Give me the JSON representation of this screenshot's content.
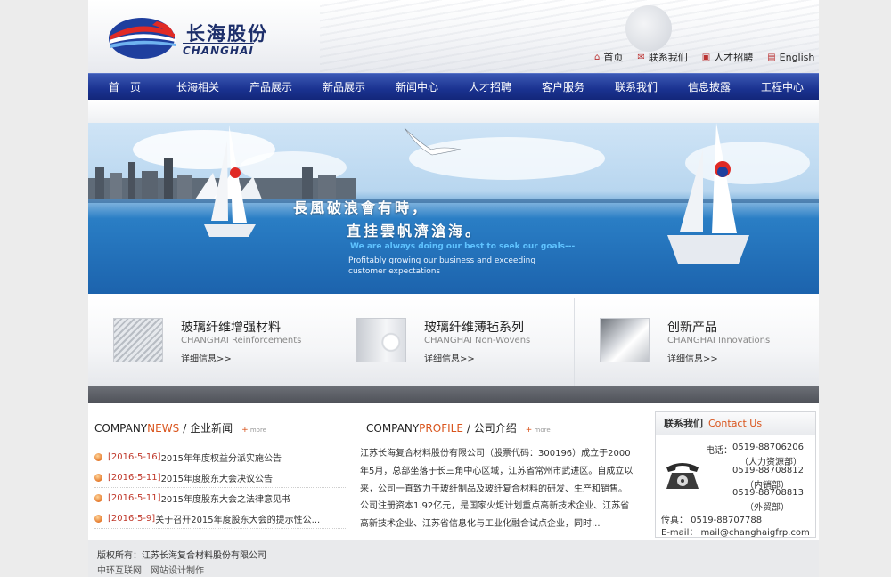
{
  "header": {
    "brand_name": "长海股份",
    "brand_en": "CHANGHAI",
    "top_links": [
      {
        "label": "首页",
        "icon": "home-icon"
      },
      {
        "label": "联系我们",
        "icon": "mail-icon"
      },
      {
        "label": "人才招聘",
        "icon": "person-icon"
      },
      {
        "label": "English",
        "icon": "doc-icon"
      }
    ]
  },
  "nav": {
    "items": [
      "首　页",
      "长海相关",
      "产品展示",
      "新品展示",
      "新闻中心",
      "人才招聘",
      "客户服务",
      "联系我们",
      "信息披露",
      "工程中心"
    ]
  },
  "banner": {
    "slogan_line1": "長風破浪會有時，",
    "slogan_line2": "直挂雲帆濟滄海。",
    "slogan_en": "We are always doing our best to seek our goals---",
    "slogan_sub1": "Profitably growing our business and exceeding",
    "slogan_sub2": "customer expectations"
  },
  "products": [
    {
      "title": "玻璃纤维增强材料",
      "en": "CHANGHAI Reinforcements",
      "more": "详细信息>>"
    },
    {
      "title": "玻璃纤维薄毡系列",
      "en": "CHANGHAI Non-Wovens",
      "more": "详细信息>>"
    },
    {
      "title": "创新产品",
      "en": "CHANGHAI Innovations",
      "more": "详细信息>>"
    }
  ],
  "news": {
    "title_part1": "COMPANY ",
    "title_part2": "NEWS",
    "title_part3": "/ 企业新闻",
    "more": "more",
    "items": [
      {
        "date": "[2016-5-16]",
        "text": "2015年年度权益分派实施公告"
      },
      {
        "date": "[2016-5-11]",
        "text": "2015年度股东大会决议公告"
      },
      {
        "date": "[2016-5-11]",
        "text": "2015年度股东大会之法律意见书"
      },
      {
        "date": "[2016-5-9]",
        "text": "关于召开2015年度股东大会的提示性公..."
      }
    ]
  },
  "profile": {
    "title_part1": "COMPANY ",
    "title_part2": "PROFILE",
    "title_part3": "/ 公司介绍",
    "more": "more",
    "text": "江苏长海复合材料股份有限公司（股票代码：300196）成立于2000年5月，总部坐落于长三角中心区域，江苏省常州市武进区。自成立以来，公司一直致力于玻纤制品及玻纤复合材料的研发、生产和销售。公司注册资本1.92亿元，是国家火炬计划重点高新技术企业、江苏省高新技术企业、江苏省信息化与工业化融合试点企业，同时..."
  },
  "contact": {
    "title_cn": "联系我们",
    "title_en": "Contact Us",
    "phone_label": "电话：",
    "phones": [
      {
        "number": "0519-88706206",
        "dept": "（人力资源部）"
      },
      {
        "number": "0519-88708812",
        "dept": "（内销部）"
      },
      {
        "number": "0519-88708813",
        "dept": "（外贸部）"
      }
    ],
    "fax": "传真： 0519-88707788",
    "email": "E-mail： mail@changhaigfrp.com"
  },
  "footer": {
    "copyright": "版权所有：江苏长海复合材料股份有限公司",
    "designer": "中环互联网　网站设计制作"
  }
}
